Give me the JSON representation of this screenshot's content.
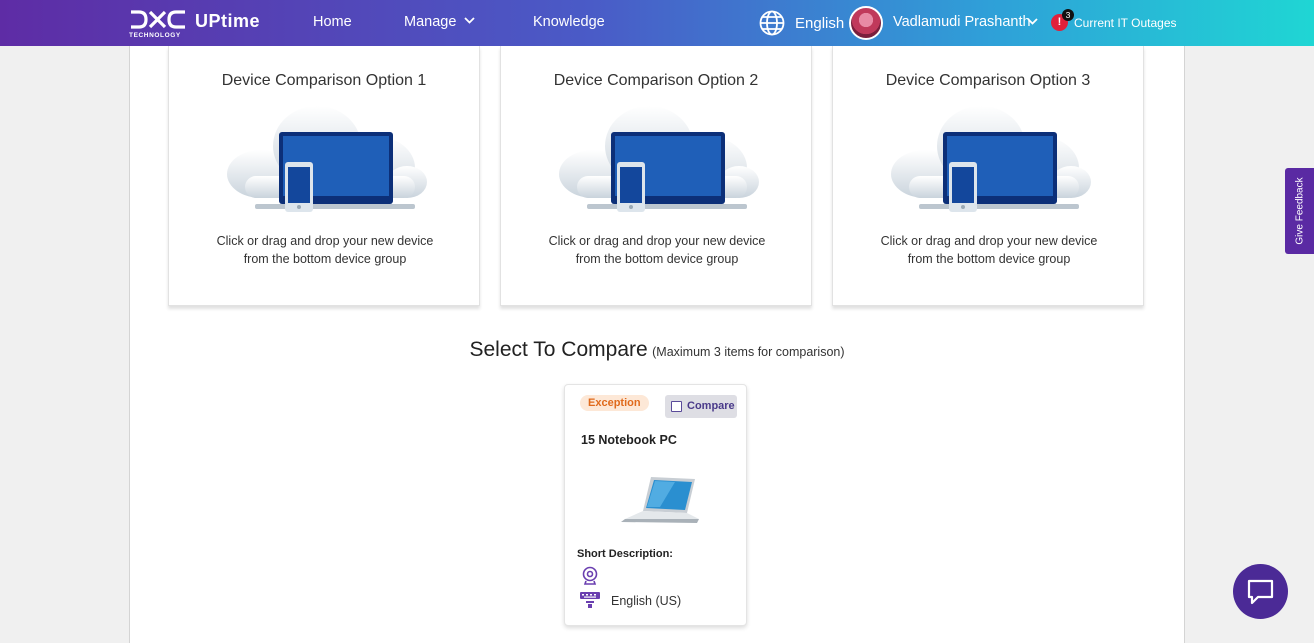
{
  "header": {
    "logo_text": "DXC",
    "logo_subtext": "TECHNOLOGY",
    "brand": "UPtime",
    "nav": {
      "home": "Home",
      "manage": "Manage",
      "knowledge": "Knowledge"
    },
    "language": "English",
    "username": "Vadlamudi Prashanth",
    "alert_symbol": "!",
    "alert_count": "3",
    "outages_label": "Current IT Outages"
  },
  "comparison_options": [
    {
      "title": "Device Comparison Option 1",
      "hint_line1": "Click or drag and drop your new device",
      "hint_line2": "from the bottom device group"
    },
    {
      "title": "Device Comparison Option 2",
      "hint_line1": "Click or drag and drop your new device",
      "hint_line2": "from the bottom device group"
    },
    {
      "title": "Device Comparison Option 3",
      "hint_line1": "Click or drag and drop your new device",
      "hint_line2": "from the bottom device group"
    }
  ],
  "select_section": {
    "heading": "Select To Compare",
    "subheading": "(Maximum 3 items for comparison)"
  },
  "device_card": {
    "badge": "Exception",
    "compare_label": "Compare",
    "compare_checked": false,
    "name": "15 Notebook PC",
    "short_description_label": "Short Description:",
    "language": "English (US)"
  },
  "feedback_label": "Give Feedback",
  "colors": {
    "brand_purple": "#5e2ca5",
    "brand_teal": "#1fd6d4",
    "badge_bg": "#fde8d7",
    "badge_text": "#e06a1c",
    "chat_button": "#4b2a96"
  },
  "icons": {
    "globe": "globe-icon",
    "manage_dropdown": "chevron-down-icon",
    "user_dropdown": "chevron-down-icon",
    "alert": "alert-icon",
    "chat": "chat-icon",
    "spec_1": "webcam-icon",
    "spec_2": "keyboard-icon"
  }
}
